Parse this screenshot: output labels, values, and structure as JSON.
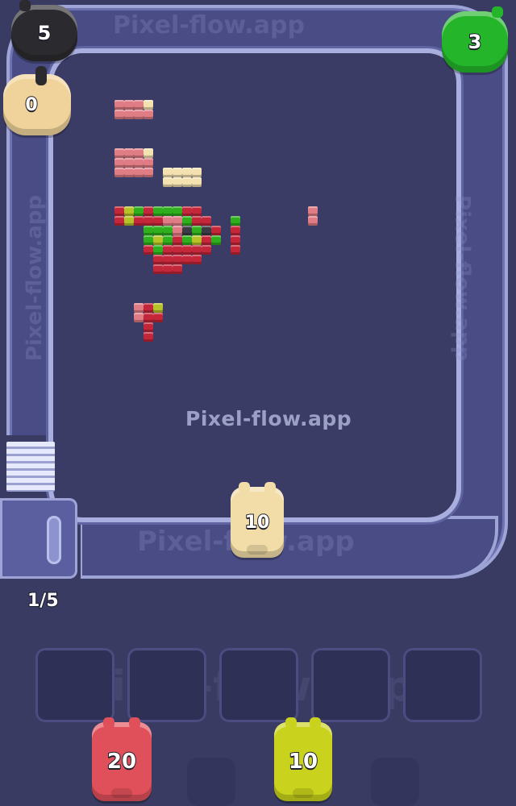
{
  "watermark": "Pixel-flow.app",
  "track_watermark": "Pixel-flow.app",
  "conveyor_counter": "1/5",
  "conveyor_pigs": [
    {
      "id": "black-pig",
      "count": "5",
      "color": "#2b2b2f"
    },
    {
      "id": "green-pig",
      "count": "3",
      "color": "#24b52a"
    },
    {
      "id": "cream-pig-left",
      "count": "0",
      "color": "#f0d39a"
    },
    {
      "id": "cream-pig-bottom",
      "count": "10",
      "color": "#f2dca8"
    }
  ],
  "queue_pigs": [
    {
      "id": "red-pig",
      "count": "20",
      "color": "#e0505a"
    },
    {
      "id": "yellow-pig",
      "count": "10",
      "color": "#c9d21c"
    }
  ],
  "slots_count": 5,
  "colors": {
    "background": "#3a3b63",
    "track": "#4a4d85",
    "track_rim": "#9ea5d6",
    "block_red": "#c4263a",
    "block_pink": "#e07c85",
    "block_cream": "#f3e2b0",
    "block_green": "#2fae1e",
    "block_yellow": "#b7c228",
    "block_dark": "#3b3b45"
  }
}
